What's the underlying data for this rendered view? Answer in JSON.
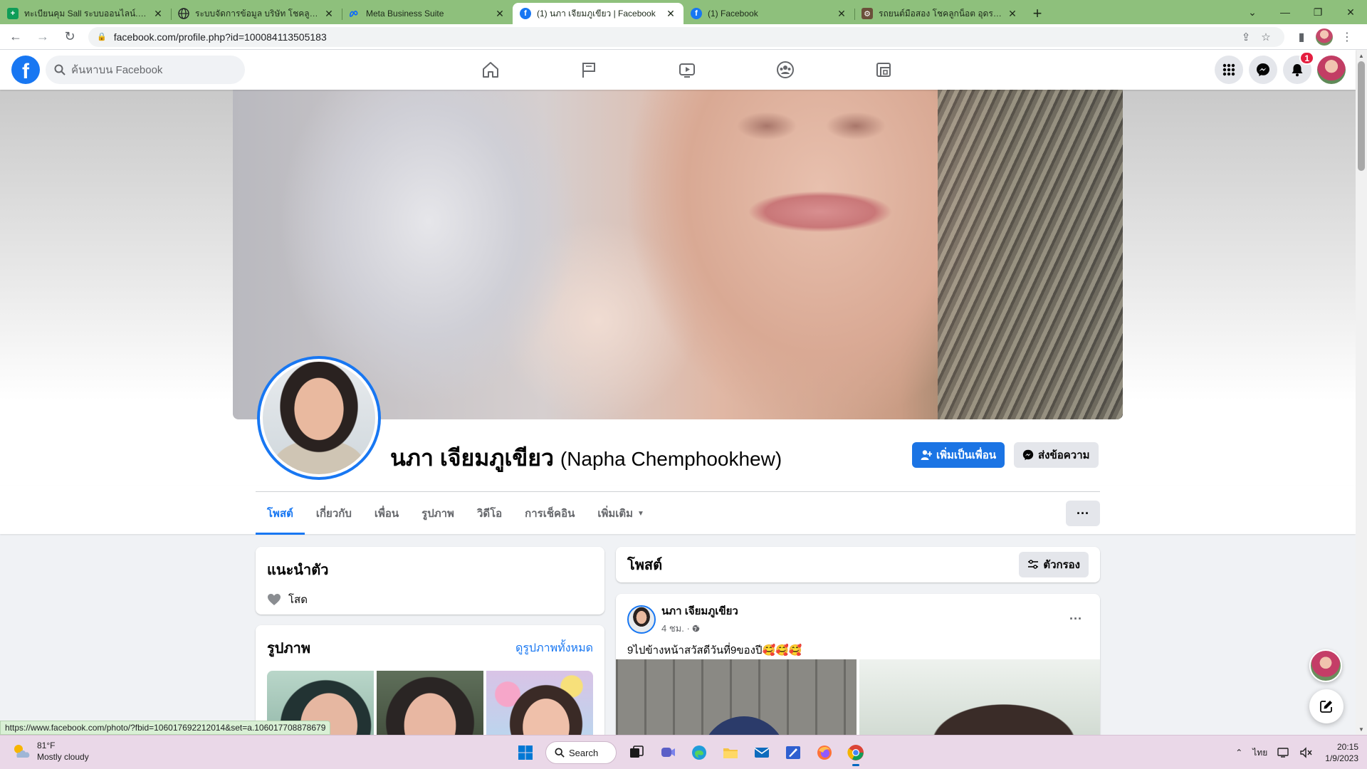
{
  "browser": {
    "tabs": [
      {
        "title": "ทะเบียนคุม Sall ระบบออนไลน์.xlsx - Google ชีต",
        "favicon_color": "#0f9d58",
        "favicon_glyph": "+",
        "active": false
      },
      {
        "title": "ระบบจัดการข้อมูล บริษัท โชคลูกน็อต อุดรธานี",
        "favicon_color": "#3c4043",
        "favicon_glyph": "globe",
        "active": false
      },
      {
        "title": "Meta Business Suite",
        "favicon_color": "#0866ff",
        "favicon_glyph": "meta",
        "active": false
      },
      {
        "title": "(1) นภา เจียมภูเขียว | Facebook",
        "favicon_color": "#1877f2",
        "favicon_glyph": "f",
        "active": true
      },
      {
        "title": "(1) Facebook",
        "favicon_color": "#1877f2",
        "favicon_glyph": "f",
        "active": false
      },
      {
        "title": "รถยนต์มือสอง โชคลูกน็อต อุดรธานี",
        "favicon_color": "#6b4f3a",
        "favicon_glyph": "car",
        "active": false
      }
    ],
    "new_tab_label": "+",
    "url": "facebook.com/profile.php?id=100084113505183",
    "status_url": "https://www.facebook.com/photo/?fbid=106017692212014&set=a.106017708878679"
  },
  "fb": {
    "search_placeholder": "ค้นหาบน Facebook",
    "notification_count": "1",
    "profile": {
      "name": "นภา เจียมภูเขียว",
      "alt_name": "(Napha Chemphookhew)",
      "add_friend_label": "เพิ่มเป็นเพื่อน",
      "message_label": "ส่งข้อความ"
    },
    "tabs": [
      "โพสต์",
      "เกี่ยวกับ",
      "เพื่อน",
      "รูปภาพ",
      "วิดีโอ",
      "การเช็คอิน",
      "เพิ่มเติม"
    ],
    "more_label": "···",
    "intro": {
      "title": "แนะนำตัว",
      "relationship": "โสด"
    },
    "photos": {
      "title": "รูปภาพ",
      "see_all": "ดูรูปภาพทั้งหมด"
    },
    "posts": {
      "title": "โพสต์",
      "filter_label": "ตัวกรอง",
      "post": {
        "author": "นภา เจียมภูเขียว",
        "time": "4 ชม. ·",
        "text": "9ไปข้างหน้าสวัสดีวันที่9ของปี🥰🥰🥰",
        "more": "···"
      }
    }
  },
  "taskbar": {
    "temperature": "81°F",
    "condition": "Mostly cloudy",
    "search_label": "Search",
    "language": "ไทย",
    "time": "20:15",
    "date": "1/9/2023"
  },
  "colors": {
    "tab_strip": "#8ec07c",
    "fb_blue": "#1877f2",
    "button_gray": "#e4e6eb",
    "page_bg": "#f0f2f5",
    "badge_red": "#e41e3f"
  }
}
